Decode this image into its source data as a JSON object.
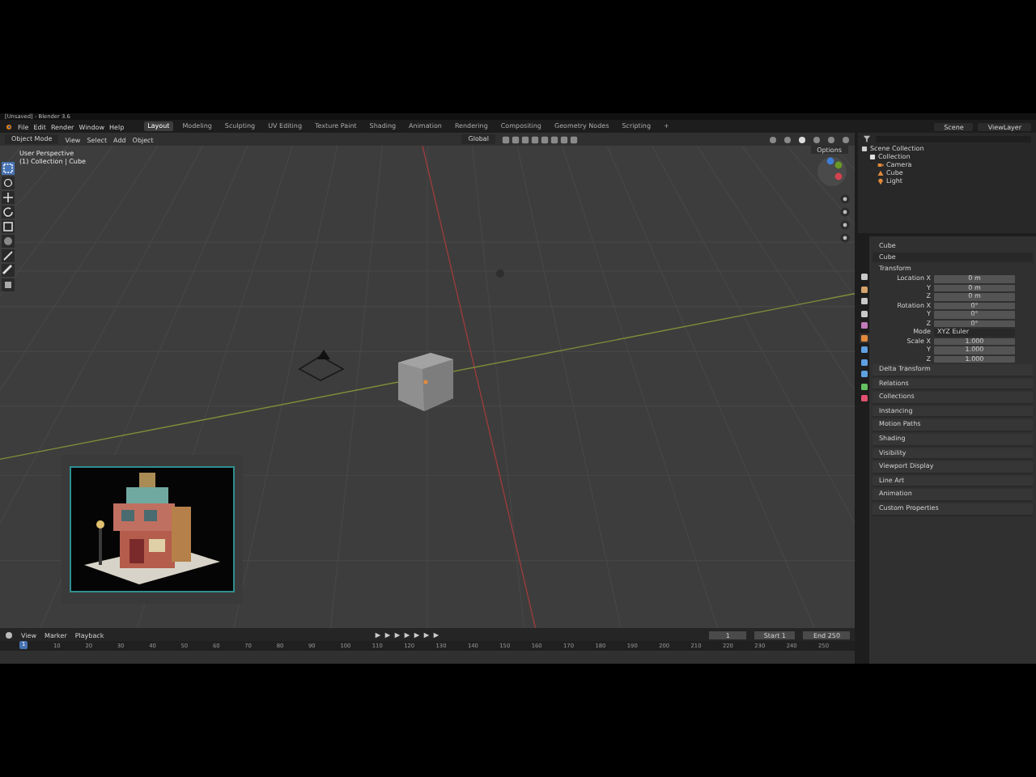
{
  "window": {
    "title": "[Unsaved] - Blender 3.6"
  },
  "menu": [
    "File",
    "Edit",
    "Render",
    "Window",
    "Help"
  ],
  "workspaces": [
    {
      "label": "Layout",
      "selected": true
    },
    {
      "label": "Modeling",
      "selected": false
    },
    {
      "label": "Sculpting",
      "selected": false
    },
    {
      "label": "UV Editing",
      "selected": false
    },
    {
      "label": "Texture Paint",
      "selected": false
    },
    {
      "label": "Shading",
      "selected": false
    },
    {
      "label": "Animation",
      "selected": false
    },
    {
      "label": "Rendering",
      "selected": false
    },
    {
      "label": "Compositing",
      "selected": false
    },
    {
      "label": "Geometry Nodes",
      "selected": false
    },
    {
      "label": "Scripting",
      "selected": false
    },
    {
      "label": "+",
      "selected": false
    }
  ],
  "scene": "Scene",
  "view_layer": "ViewLayer",
  "viewport": {
    "mode": "Object Mode",
    "menu": [
      "View",
      "Select",
      "Add",
      "Object"
    ],
    "orientation": "Global",
    "options": "Options",
    "overlay_title": "User Perspective",
    "overlay_subtitle": "(1) Collection | Cube"
  },
  "outliner": {
    "items": [
      {
        "label": "Scene Collection",
        "kind": "scene",
        "children": [
          {
            "label": "Collection",
            "kind": "collection",
            "children": [
              {
                "label": "Camera",
                "kind": "camera"
              },
              {
                "label": "Cube",
                "kind": "mesh"
              },
              {
                "label": "Light",
                "kind": "light"
              }
            ]
          }
        ]
      }
    ]
  },
  "property_tabs": [
    {
      "color": "#c8c8c8",
      "selected": false
    },
    {
      "color": "#d4a26b",
      "selected": false
    },
    {
      "color": "#c8c8c8",
      "selected": false
    },
    {
      "color": "#c8c8c8",
      "selected": false
    },
    {
      "color": "#c07ab8",
      "selected": false
    },
    {
      "color": "#e08a3c",
      "selected": true
    },
    {
      "color": "#5fa0e0",
      "selected": false
    },
    {
      "color": "#5fa0e0",
      "selected": false
    },
    {
      "color": "#5fa0e0",
      "selected": false
    },
    {
      "color": "#63c060",
      "selected": false
    },
    {
      "color": "#e05070",
      "selected": false
    }
  ],
  "properties": {
    "object": "Cube",
    "name": "Cube",
    "section": "Transform",
    "rows": [
      {
        "kind": "number",
        "label": "Location X",
        "value": "0 m"
      },
      {
        "kind": "number",
        "label": "Y",
        "value": "0 m"
      },
      {
        "kind": "number",
        "label": "Z",
        "value": "0 m"
      },
      {
        "kind": "number",
        "label": "Rotation X",
        "value": "0°"
      },
      {
        "kind": "number",
        "label": "Y",
        "value": "0°"
      },
      {
        "kind": "number",
        "label": "Z",
        "value": "0°"
      },
      {
        "kind": "dropdown",
        "label": "Mode",
        "value": "XYZ Euler"
      },
      {
        "kind": "number",
        "label": "Scale X",
        "value": "1.000"
      },
      {
        "kind": "number",
        "label": "Y",
        "value": "1.000"
      },
      {
        "kind": "number",
        "label": "Z",
        "value": "1.000"
      }
    ],
    "panels": [
      "Delta Transform",
      "Relations",
      "Collections",
      "Instancing",
      "Motion Paths",
      "Shading",
      "Visibility",
      "Viewport Display",
      "Line Art",
      "Animation",
      "Custom Properties"
    ]
  },
  "timeline": {
    "menu": [
      "View",
      "Marker",
      "Playback"
    ],
    "current_frame": "1",
    "start_label": "Start",
    "start": "1",
    "end_label": "End",
    "end": "250",
    "cursor": "1",
    "ticks": [
      "10",
      "20",
      "30",
      "40",
      "50",
      "60",
      "70",
      "80",
      "90",
      "100",
      "110",
      "120",
      "130",
      "140",
      "150",
      "160",
      "170",
      "180",
      "190",
      "200",
      "210",
      "220",
      "230",
      "240",
      "250"
    ]
  }
}
